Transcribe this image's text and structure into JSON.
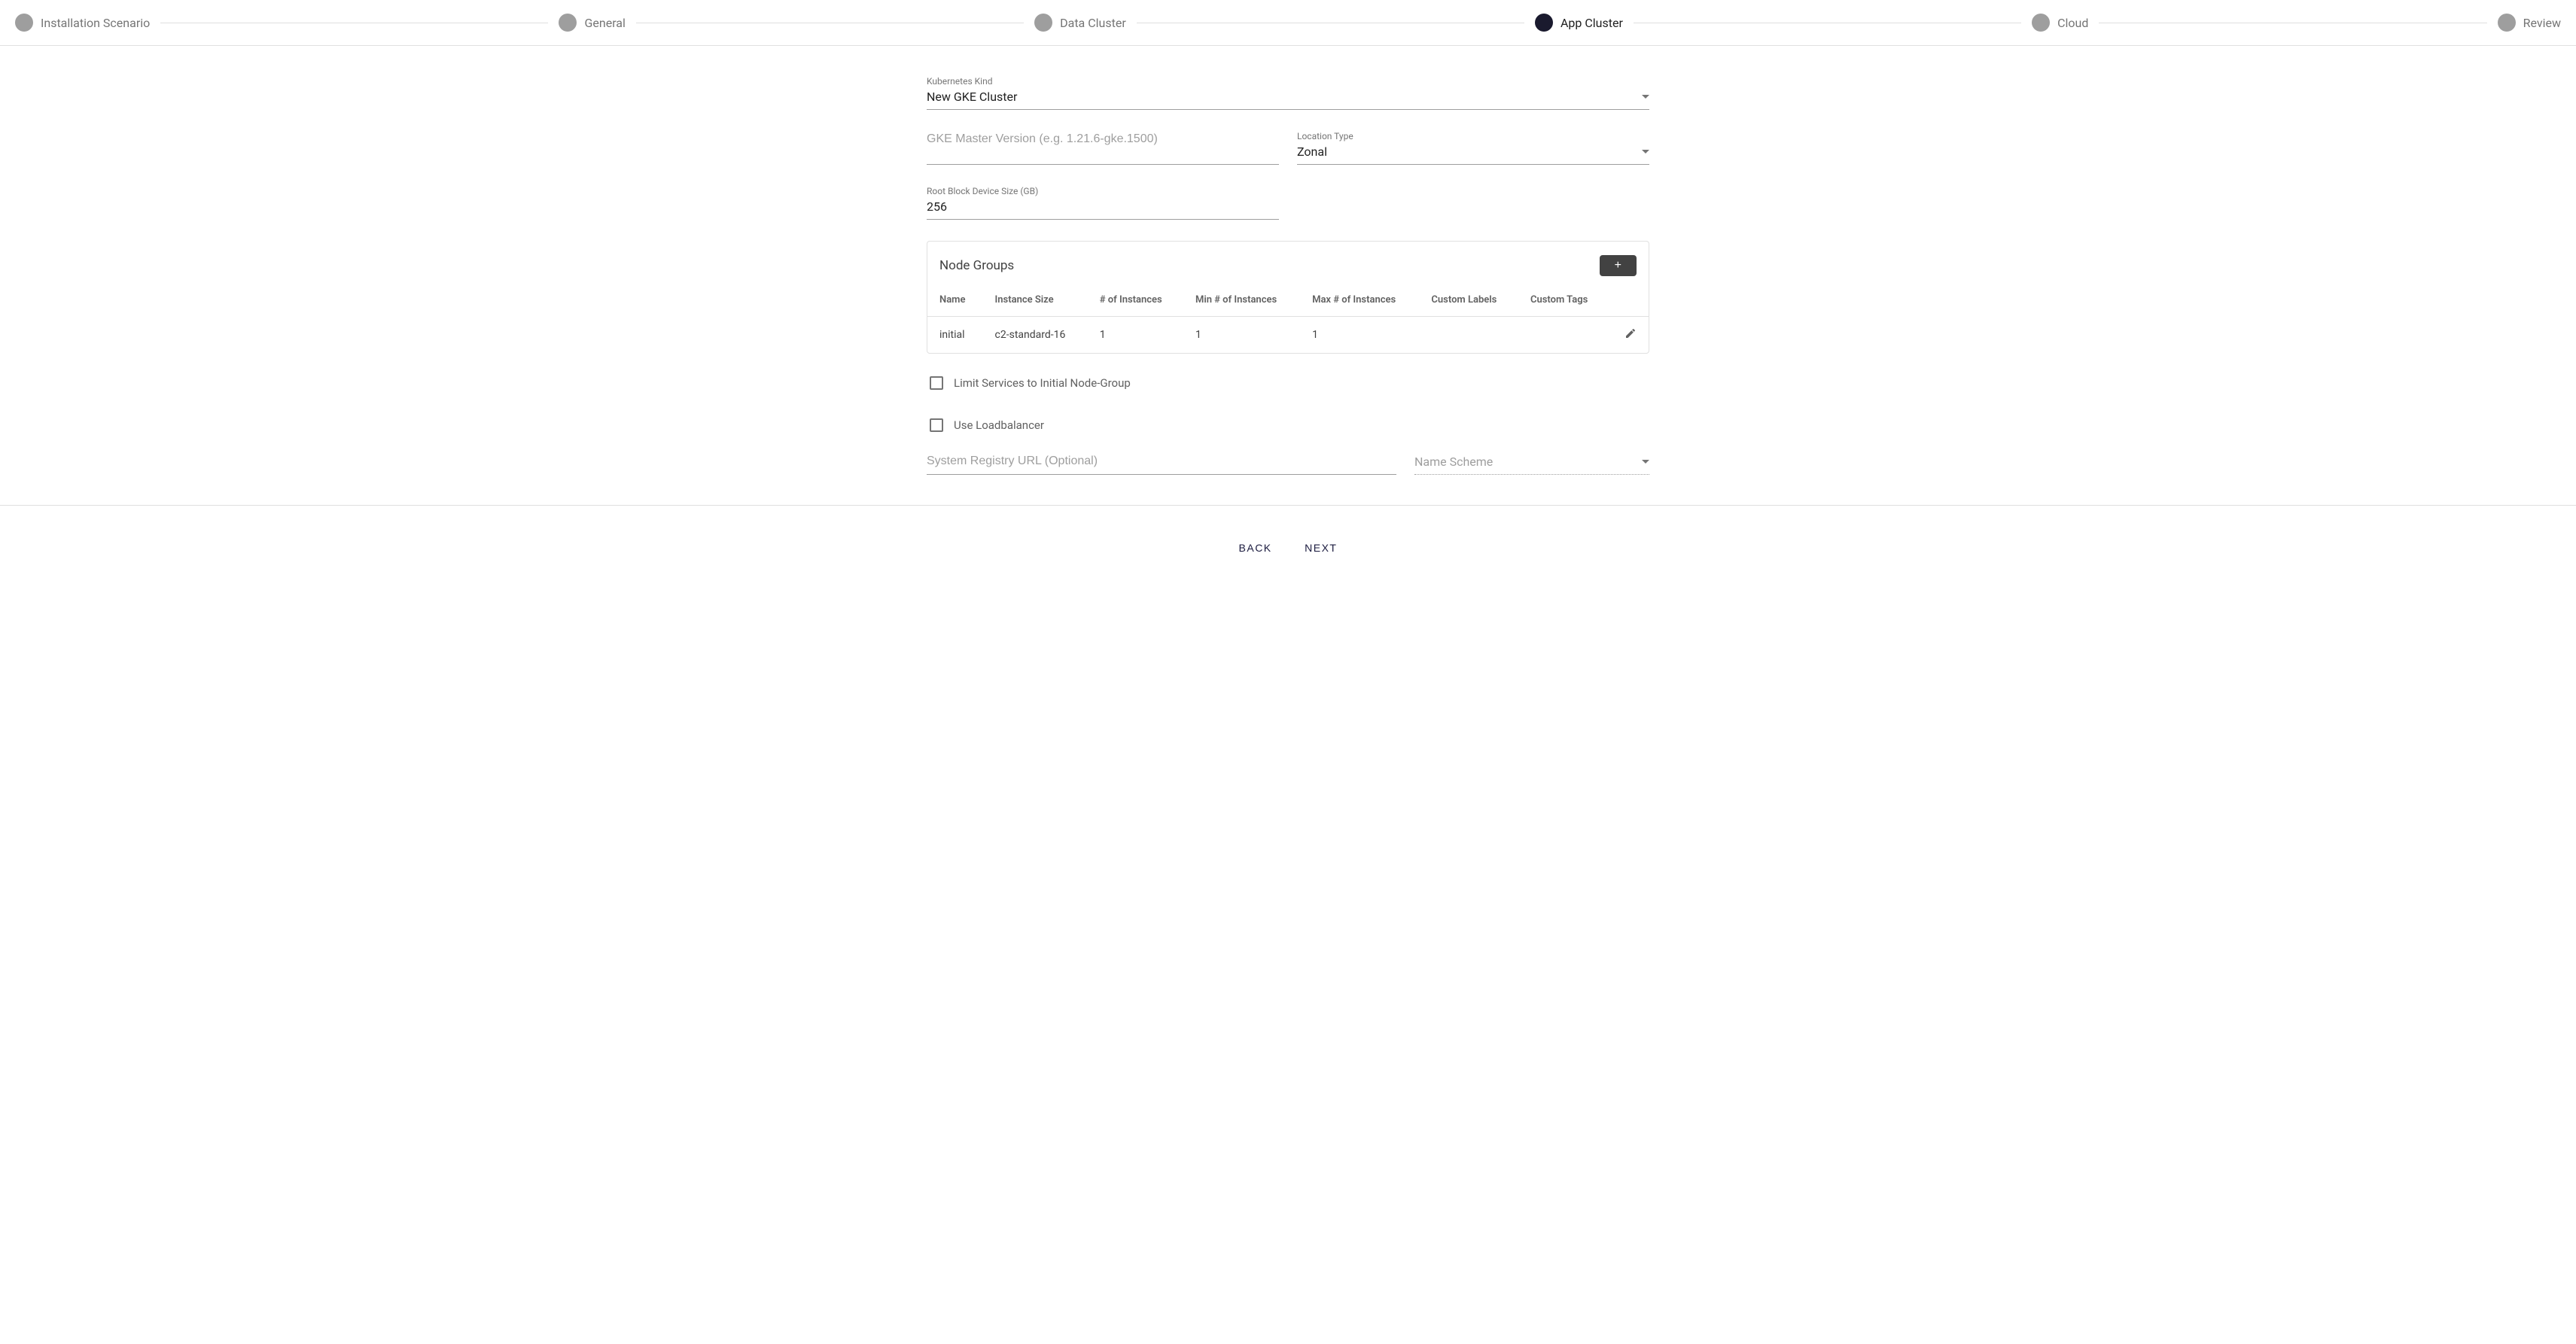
{
  "stepper": [
    {
      "label": "Installation Scenario",
      "active": false
    },
    {
      "label": "General",
      "active": false
    },
    {
      "label": "Data Cluster",
      "active": false
    },
    {
      "label": "App Cluster",
      "active": true
    },
    {
      "label": "Cloud",
      "active": false
    },
    {
      "label": "Review",
      "active": false
    }
  ],
  "form": {
    "kubernetes_kind": {
      "label": "Kubernetes Kind",
      "value": "New GKE Cluster"
    },
    "gke_master_version": {
      "placeholder": "GKE Master Version (e.g. 1.21.6-gke.1500)",
      "value": ""
    },
    "location_type": {
      "label": "Location Type",
      "value": "Zonal"
    },
    "root_block": {
      "label": "Root Block Device Size (GB)",
      "value": "256"
    },
    "system_registry": {
      "placeholder": "System Registry URL (Optional)",
      "value": ""
    },
    "name_scheme": {
      "placeholder": "Name Scheme",
      "value": ""
    }
  },
  "node_groups": {
    "title": "Node Groups",
    "add_label": "+",
    "columns": [
      "Name",
      "Instance Size",
      "# of Instances",
      "Min # of Instances",
      "Max # of Instances",
      "Custom Labels",
      "Custom Tags"
    ],
    "rows": [
      {
        "name": "initial",
        "instance_size": "c2-standard-16",
        "instances": "1",
        "min": "1",
        "max": "1",
        "labels": "",
        "tags": ""
      }
    ]
  },
  "checkboxes": {
    "limit_services": {
      "label": "Limit Services to Initial Node-Group",
      "checked": false
    },
    "use_loadbalancer": {
      "label": "Use Loadbalancer",
      "checked": false
    }
  },
  "buttons": {
    "back": "BACK",
    "next": "NEXT"
  }
}
